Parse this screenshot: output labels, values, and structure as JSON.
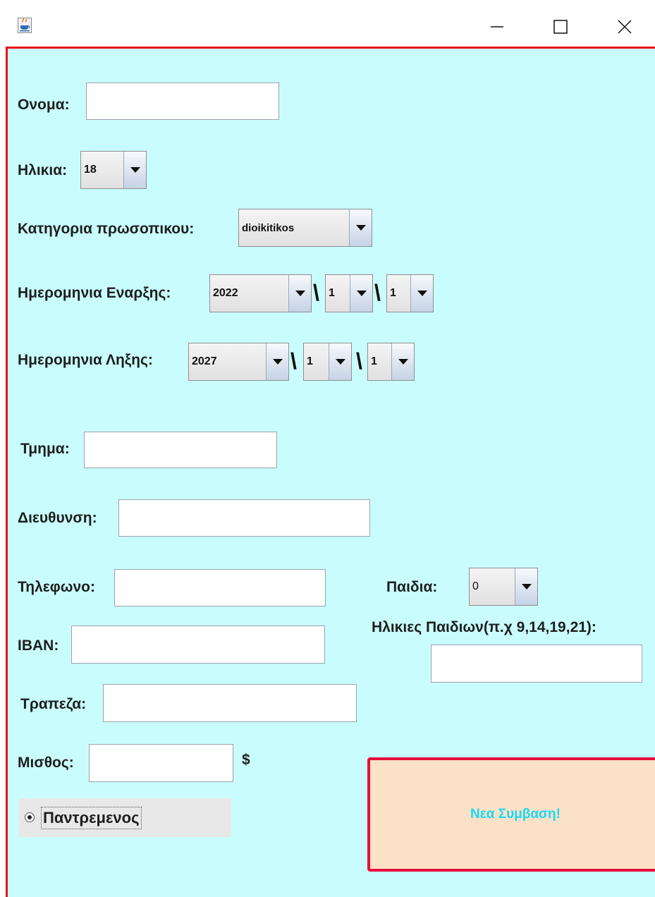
{
  "window": {
    "minimize_icon": "minimize-icon",
    "maximize_icon": "maximize-icon",
    "close_icon": "close-icon",
    "app_icon": "java-cup-icon"
  },
  "form": {
    "name_label": "Ονομα:",
    "name_value": "",
    "age_label": "Ηλικια:",
    "age_value": "18",
    "category_label": "Κατηγορια πρωσοπικου:",
    "category_value": "dioikitikos",
    "start_date_label": "Ημερομηνια Εναρξης:",
    "start_year": "2022",
    "start_month": "1",
    "start_day": "1",
    "end_date_label": "Ημερομηνια Ληξης:",
    "end_year": "2027",
    "end_month": "1",
    "end_day": "1",
    "date_separator": "\\",
    "department_label": "Τμημα:",
    "address_label": "Διευθυνση:",
    "phone_label": "Τηλεφωνο:",
    "iban_label": "IBAN:",
    "bank_label": "Τραπεζα:",
    "salary_label": "Μισθος:",
    "currency_symbol": "$",
    "children_label": "Παιδια:",
    "children_value": "0",
    "children_ages_label": "Ηλικιες Παιδιων(π.χ 9,14,19,21):",
    "married_label": "Παντρεμενος",
    "married_selected": true,
    "submit_label": "Νεα Συμβαση!"
  },
  "colors": {
    "panel_bg": "#c9fdfd",
    "frame_border": "#e6101a",
    "button_bg": "#fbe1c6",
    "button_border": "#e6103a",
    "button_text": "#19d8f6"
  }
}
